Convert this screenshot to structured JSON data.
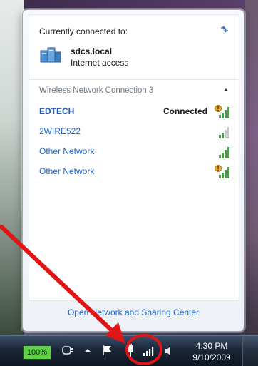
{
  "flyout": {
    "connected_to_label": "Currently connected to:",
    "current_network": {
      "name": "sdcs.local",
      "status": "Internet access"
    },
    "section_title": "Wireless Network Connection 3",
    "networks": [
      {
        "name": "EDTECH",
        "state": "Connected",
        "icon": "secured-signal-icon",
        "bold": true
      },
      {
        "name": "2WIRE522",
        "state": "",
        "icon": "signal-icon",
        "bold": false
      },
      {
        "name": "Other Network",
        "state": "",
        "icon": "signal-icon",
        "bold": false
      },
      {
        "name": "Other Network",
        "state": "",
        "icon": "secured-signal-icon",
        "bold": false
      }
    ],
    "footer_link": "Open Network and Sharing Center"
  },
  "taskbar": {
    "battery": "100%",
    "time": "4:30 PM",
    "date": "9/10/2009"
  },
  "colors": {
    "link": "#1e66c8",
    "annotation_red": "#e01515",
    "signal_green": "#3aa83a"
  }
}
